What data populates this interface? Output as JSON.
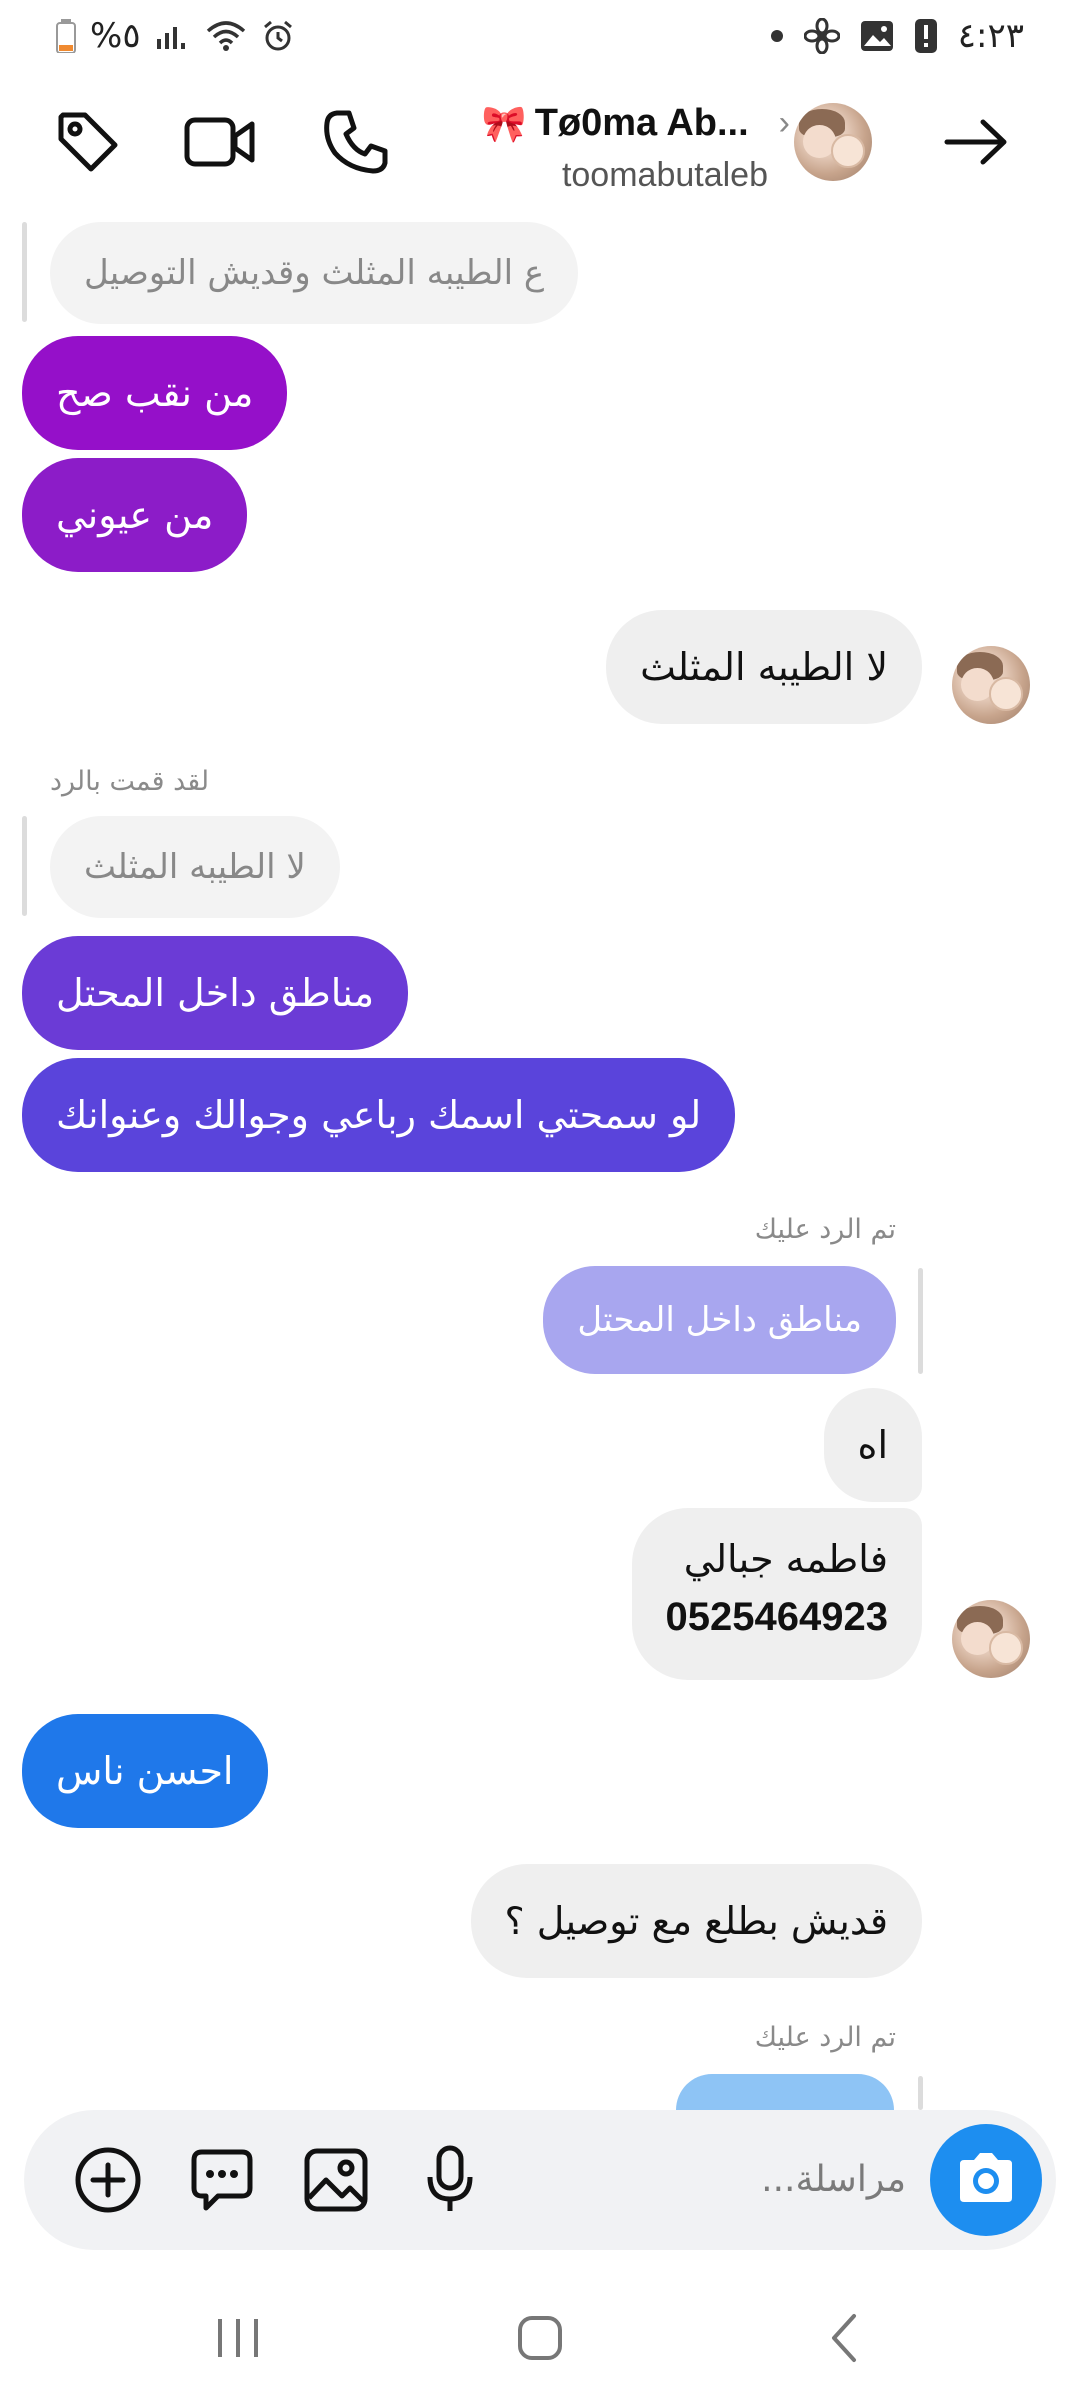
{
  "status_bar": {
    "battery_percent": "%٥",
    "time": "٤:٢٣"
  },
  "header": {
    "title": "Tø0ma Ab...",
    "title_emoji": "🎀",
    "username": "toomabutaleb",
    "back_icon": "arrow-right-icon",
    "call_icon": "phone-icon",
    "video_icon": "video-camera-icon",
    "tag_icon": "tag-icon"
  },
  "messages": [
    {
      "type": "reply_quote",
      "text": "ع الطيبه المثلث وقديش التوصيل"
    },
    {
      "type": "incoming",
      "text": "من نقب صح",
      "color": "#9510c9"
    },
    {
      "type": "incoming",
      "text": "من عيوني",
      "color": "#8c1cc8"
    },
    {
      "type": "outgoing",
      "text": "لا الطيبه المثلث"
    },
    {
      "type": "reply_label",
      "text": "لقد قمت بالرد"
    },
    {
      "type": "reply_quote",
      "text": "لا الطيبه المثلث"
    },
    {
      "type": "incoming",
      "text": "مناطق داخل المحتل",
      "color": "#6b3bd6"
    },
    {
      "type": "incoming",
      "text": "لو سمحتي اسمك رباعي وجوالك وعنوانك",
      "color": "#5a44db"
    },
    {
      "type": "reply_label",
      "text": "تم الرد عليك"
    },
    {
      "type": "reply_quote_colored",
      "text": "مناطق داخل المحتل",
      "color": "#a8a6ef"
    },
    {
      "type": "outgoing",
      "text": "اه"
    },
    {
      "type": "outgoing_multiline",
      "line1": "فاطمه جبالي",
      "line2": "0525464923"
    },
    {
      "type": "incoming",
      "text": "احسن ناس",
      "color": "#1f78ea"
    },
    {
      "type": "outgoing",
      "text": "قديش بطلع مع توصيل ؟"
    },
    {
      "type": "reply_label",
      "text": "تم الرد عليك"
    }
  ],
  "composer": {
    "placeholder": "مراسلة..."
  },
  "colors": {
    "camera_button": "#1d8ef0",
    "partial_bubble": "#8ec4f5"
  }
}
